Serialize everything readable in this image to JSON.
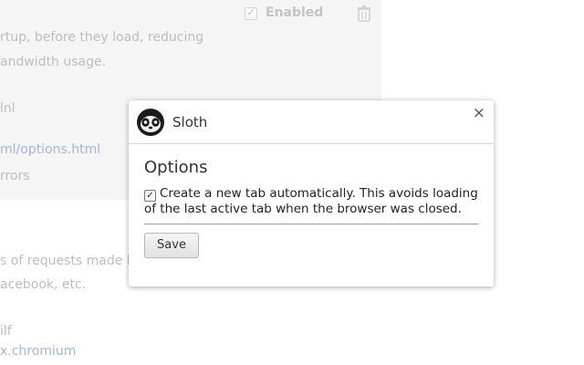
{
  "background": {
    "enabled_label": "Enabled",
    "lines": [
      "rtup, before they load, reducing",
      "andwidth usage.",
      "lnl",
      "ml/options.html",
      "rrors",
      "s of requests made by",
      "acebook, etc.",
      "ilf",
      "x.chromium"
    ]
  },
  "dialog": {
    "extension_name": "Sloth",
    "close_symbol": "×",
    "options_title": "Options",
    "checkbox_checked": true,
    "checkbox_label": "Create a new tab automatically. This avoids loading of the last active tab when the browser was closed.",
    "save_label": "Save"
  },
  "icons": {
    "extension": "sloth-face-icon",
    "close": "close-icon",
    "trash": "trash-icon"
  }
}
